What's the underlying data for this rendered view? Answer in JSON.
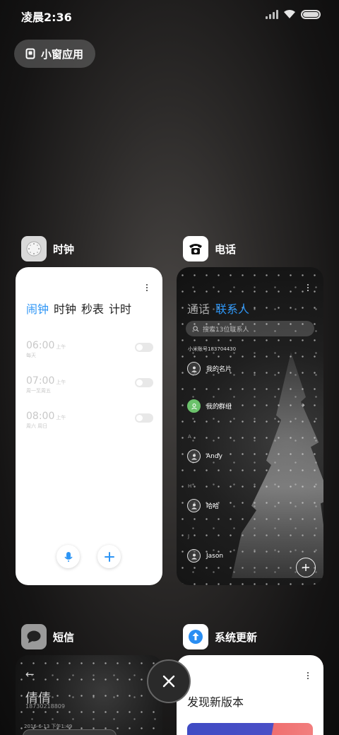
{
  "status": {
    "time": "凌晨2:36"
  },
  "pill": {
    "label": "小窗应用",
    "icon": "small-window-icon"
  },
  "apps": {
    "clock": {
      "name": "时钟",
      "icon": "clock-icon",
      "tabs": [
        "闹钟",
        "时钟",
        "秒表",
        "计时"
      ],
      "active_tab": 0,
      "alarms": [
        {
          "time": "06:00",
          "ampm": "上午",
          "repeat": "每天",
          "enabled": false
        },
        {
          "time": "07:00",
          "ampm": "上午",
          "repeat": "周一至周五",
          "enabled": false
        },
        {
          "time": "08:00",
          "ampm": "上午",
          "repeat": "周六 周日",
          "enabled": false
        }
      ],
      "icons": [
        "microphone-icon",
        "add-icon"
      ]
    },
    "phone": {
      "name": "电话",
      "icon": "phone-icon",
      "tabs": [
        "通话",
        "联系人"
      ],
      "active_tab": 1,
      "search_placeholder": "搜索13位联系人",
      "account": "小米账号183704430",
      "contacts": [
        {
          "name": "我的名片",
          "index": ""
        },
        {
          "name": "我的群组",
          "index": ""
        },
        {
          "name": "Andy",
          "index": "A"
        },
        {
          "name": "哈哈",
          "index": "H"
        },
        {
          "name": "Jason",
          "index": "J"
        }
      ]
    },
    "sms": {
      "name": "短信",
      "icon": "message-icon",
      "contact": "倩倩",
      "number": "18730218809",
      "date": "2016-6-13 下午1:49"
    },
    "update": {
      "name": "系统更新",
      "icon": "update-arrow-icon",
      "title": "发现新版本"
    }
  },
  "close_icon": "close-icon"
}
